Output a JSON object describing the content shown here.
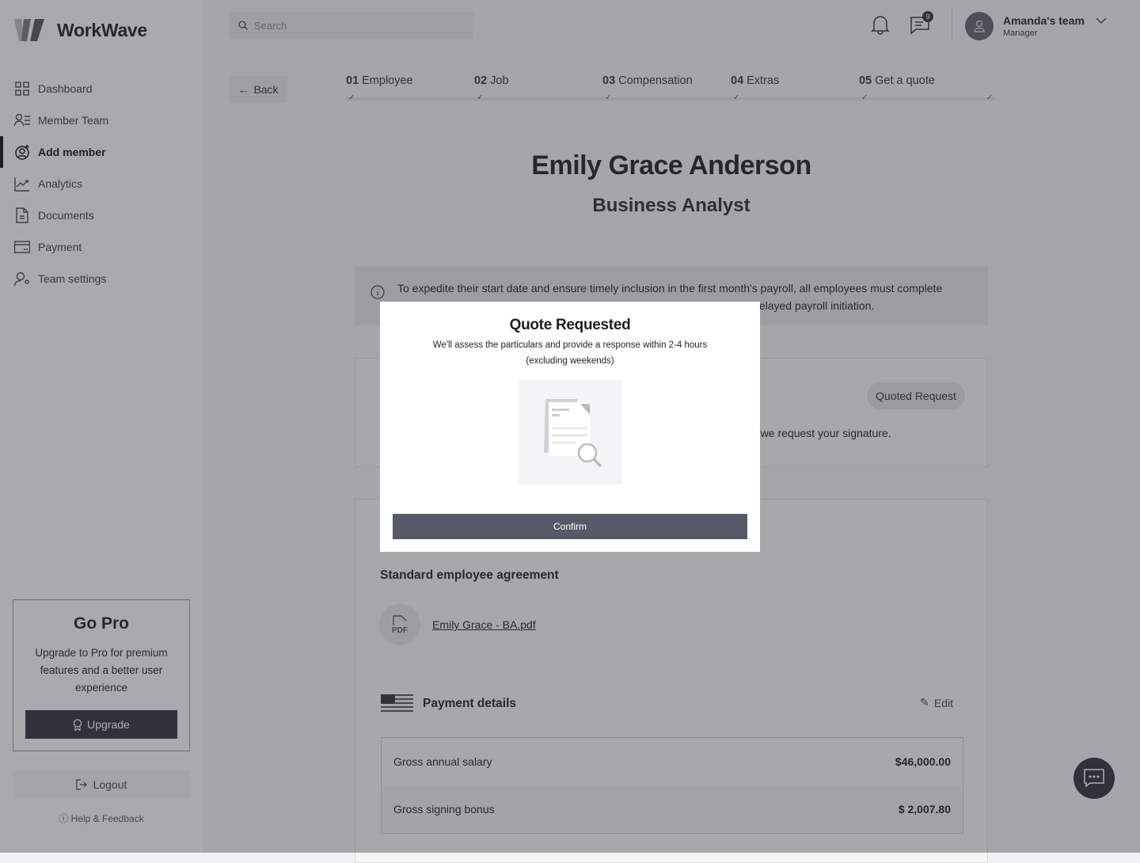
{
  "app": {
    "name": "WorkWave"
  },
  "sidebar": {
    "items": [
      {
        "label": "Dashboard",
        "icon": "grid-icon"
      },
      {
        "label": "Member Team",
        "icon": "user-list-icon"
      },
      {
        "label": "Add member",
        "icon": "user-plus-icon",
        "active": true
      },
      {
        "label": "Analytics",
        "icon": "chart-icon"
      },
      {
        "label": "Documents",
        "icon": "document-icon"
      },
      {
        "label": "Payment",
        "icon": "card-icon"
      },
      {
        "label": "Team settings",
        "icon": "user-gear-icon"
      }
    ],
    "gopro": {
      "title": "Go Pro",
      "text": "Upgrade to Pro for premium features and a better user experience",
      "button": "Upgrade"
    },
    "logout": "Logout",
    "help": "Help & Feedback"
  },
  "header": {
    "search_placeholder": "Search",
    "messages_badge": "9",
    "team": "Amanda's team",
    "role": "Manager"
  },
  "back": "Back",
  "steps": [
    {
      "num": "01",
      "label": "Employee"
    },
    {
      "num": "02",
      "label": "Job"
    },
    {
      "num": "03",
      "label": "Compensation"
    },
    {
      "num": "04",
      "label": "Extras"
    },
    {
      "num": "05",
      "label": "Get a quote"
    }
  ],
  "employee": {
    "name": "Emily Grace Anderson",
    "title": "Business Analyst"
  },
  "info": {
    "line1": "To expedite their start date and ensure timely inclusion in the first month's payroll, all employees must complete",
    "line2": "onboarding by September 15, 2023. Missing this deadline will result in a delayed payroll initiation."
  },
  "quote_card": {
    "status": "Quoted Request",
    "text": "e we request your signature."
  },
  "agreement": {
    "title": "Standard employee agreement",
    "file": "Emily Grace - BA.pdf",
    "pdf_label": "PDF"
  },
  "payment": {
    "title": "Payment details",
    "edit": "Edit",
    "rows": [
      {
        "label": "Gross annual salary",
        "value": "$46,000.00"
      },
      {
        "label": "Gross signing bonus",
        "value": "$ 2,007.80"
      }
    ]
  },
  "modal": {
    "title": "Quote Requested",
    "line1": "We'll assess the particulars and provide a response within 2-4 hours",
    "line2": "(excluding weekends)",
    "confirm": "Confirm"
  }
}
